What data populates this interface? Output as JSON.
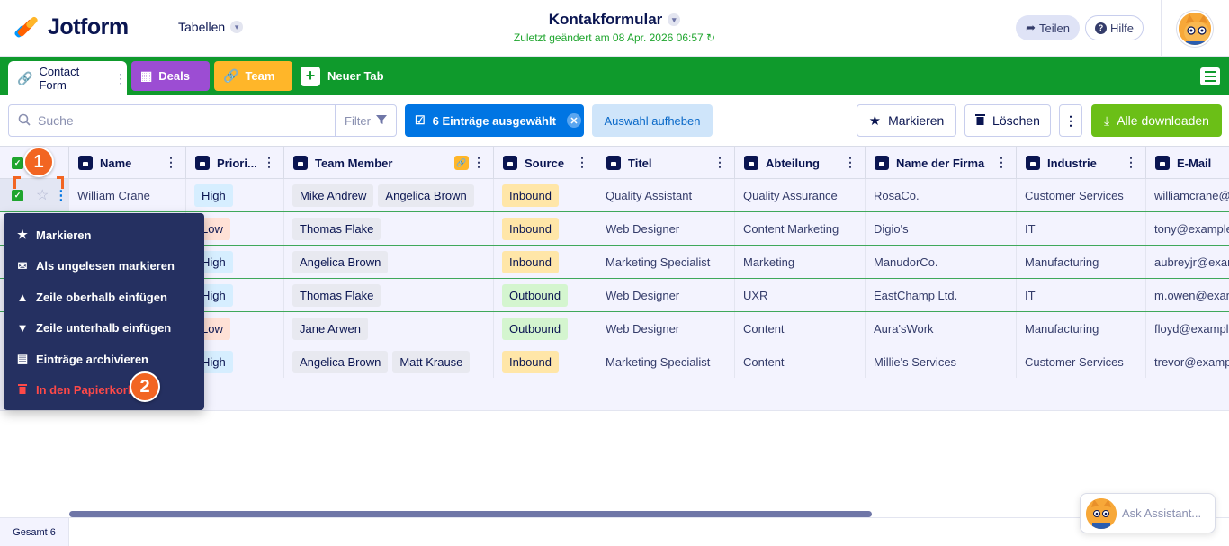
{
  "header": {
    "brand": "Jotform",
    "tables_label": "Tabellen",
    "form_title": "Kontakformular",
    "last_changed": "Zuletzt geändert am 08 Apr. 2026 06:57",
    "share_label": "Teilen",
    "help_label": "Hilfe"
  },
  "tabs": {
    "contact": "Contact Form",
    "deals": "Deals",
    "team": "Team",
    "new": "Neuer Tab"
  },
  "toolbar": {
    "search_placeholder": "Suche",
    "filter_label": "Filter",
    "selected_label": "6 Einträge ausgewählt",
    "unselect_label": "Auswahl aufheben",
    "star_label": "Markieren",
    "delete_label": "Löschen",
    "download_label": "Alle downloaden"
  },
  "columns": [
    "Name",
    "Priori...",
    "Team Member",
    "Source",
    "Titel",
    "Abteilung",
    "Name der Firma",
    "Industrie",
    "E-Mail"
  ],
  "rows": [
    {
      "name": "William Crane",
      "priority": "High",
      "members": [
        "Mike Andrew",
        "Angelica Brown"
      ],
      "source": "Inbound",
      "title": "Quality Assistant",
      "dept": "Quality Assurance",
      "company": "RosaCo.",
      "industry": "Customer Services",
      "email": "williamcrane@"
    },
    {
      "name": "",
      "priority": "Low",
      "members": [
        "Thomas Flake"
      ],
      "source": "Inbound",
      "title": "Web Designer",
      "dept": "Content Marketing",
      "company": "Digio's",
      "industry": "IT",
      "email": "tony@example"
    },
    {
      "name": "",
      "priority": "High",
      "members": [
        "Angelica Brown"
      ],
      "source": "Inbound",
      "title": "Marketing Specialist",
      "dept": "Marketing",
      "company": "ManudorCo.",
      "industry": "Manufacturing",
      "email": "aubreyjr@exam"
    },
    {
      "name": "",
      "priority": "High",
      "members": [
        "Thomas Flake"
      ],
      "source": "Outbound",
      "title": "Web Designer",
      "dept": "UXR",
      "company": "EastChamp Ltd.",
      "industry": "IT",
      "email": "m.owen@exam"
    },
    {
      "name": "",
      "priority": "Low",
      "members": [
        "Jane Arwen"
      ],
      "source": "Outbound",
      "title": "Web Designer",
      "dept": "Content",
      "company": "Aura'sWork",
      "industry": "Manufacturing",
      "email": "floyd@example"
    },
    {
      "name": "",
      "priority": "High",
      "members": [
        "Angelica Brown",
        "Matt Krause"
      ],
      "source": "Inbound",
      "title": "Marketing Specialist",
      "dept": "Content",
      "company": "Millie's Services",
      "industry": "Customer Services",
      "email": "trevor@examp"
    }
  ],
  "context_menu": {
    "star": "Markieren",
    "mark_unread": "Als ungelesen markieren",
    "insert_above": "Zeile oberhalb einfügen",
    "insert_below": "Zeile unterhalb einfügen",
    "archive": "Einträge archivieren",
    "trash": "In den Papierkorb"
  },
  "markers": {
    "one": "1",
    "two": "2"
  },
  "footer": {
    "total": "Gesamt 6"
  },
  "assistant": {
    "placeholder": "Ask Assistant..."
  },
  "colors": {
    "brand_green": "#0f9a2c",
    "selection_blue": "#0075e3",
    "download_green": "#6bbf17",
    "marker_orange": "#f26522",
    "menu_bg": "#253061",
    "danger": "#ff4948"
  }
}
